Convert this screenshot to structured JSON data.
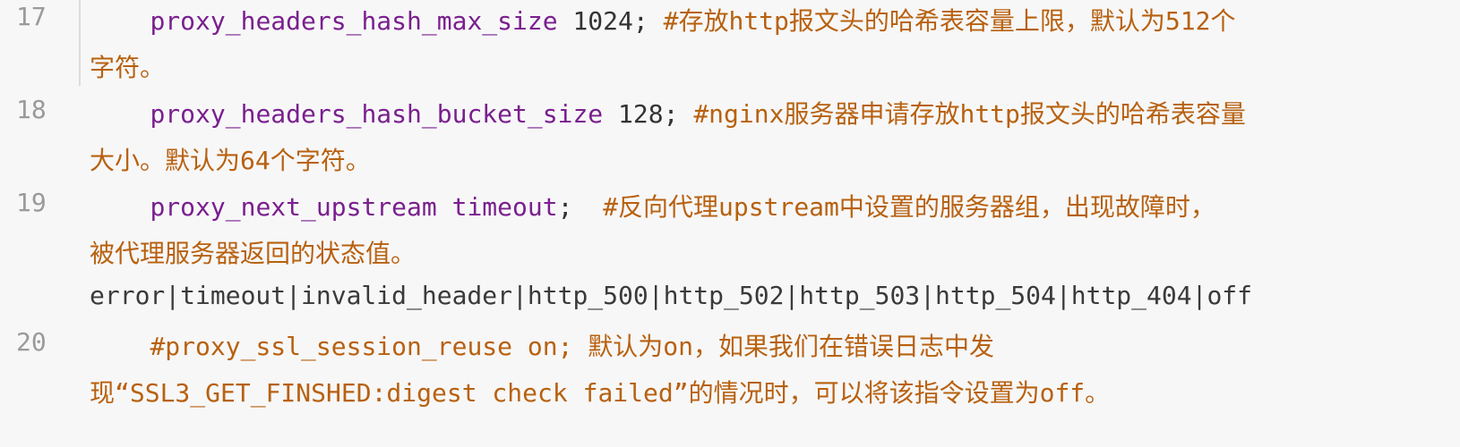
{
  "lines": [
    {
      "number": "17",
      "rows": [
        {
          "indent": "    ",
          "kw": "proxy_headers_hash_max_size",
          "val": " 1024",
          "punc": ";",
          "comment": " #存放http报文头的哈希表容量上限，默认为512个"
        },
        {
          "comment": "字符。"
        }
      ]
    },
    {
      "number": "18",
      "rows": [
        {
          "indent": "    ",
          "kw": "proxy_headers_hash_bucket_size",
          "val": " 128",
          "punc": ";",
          "comment": " #nginx服务器申请存放http报文头的哈希表容量"
        },
        {
          "comment": "大小。默认为64个字符。"
        }
      ]
    },
    {
      "number": "19",
      "rows": [
        {
          "indent": "    ",
          "kw": "proxy_next_upstream timeout",
          "punc": ";",
          "comment": "  #反向代理upstream中设置的服务器组，出现故障时，"
        },
        {
          "comment": "被代理服务器返回的状态值。"
        },
        {
          "plain": "error|timeout|invalid_header|http_500|http_502|http_503|http_504|http_404|off"
        }
      ]
    },
    {
      "number": "20",
      "rows": [
        {
          "indent": "    ",
          "comment": "#proxy_ssl_session_reuse on; 默认为on，如果我们在错误日志中发"
        },
        {
          "comment": "现“SSL3_GET_FINSHED:digest check failed”的情况时，可以将该指令设置为off。"
        }
      ]
    }
  ]
}
